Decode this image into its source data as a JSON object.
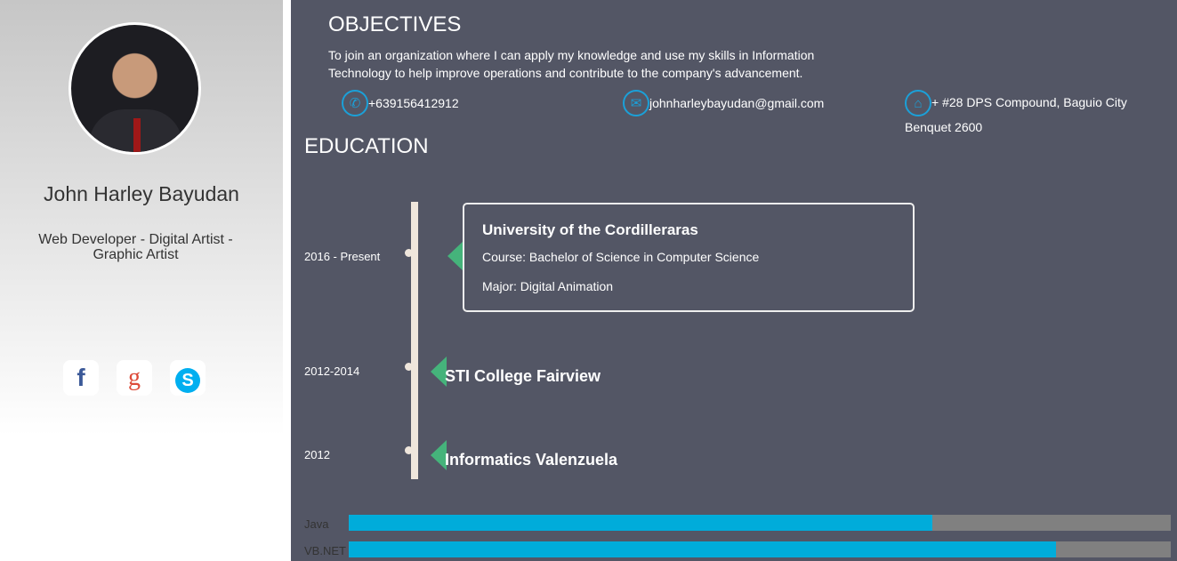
{
  "profile": {
    "name": "John Harley Bayudan",
    "role": "Web Developer - Digital Artist - Graphic Artist"
  },
  "social": [
    {
      "icon": "facebook-icon",
      "glyph": "f",
      "color": "#3b5998"
    },
    {
      "icon": "google-icon",
      "glyph": "g",
      "color": "#dd4b39"
    },
    {
      "icon": "skype-icon",
      "glyph": "S",
      "color": "#00aff0"
    }
  ],
  "objectives": {
    "title": "OBJECTIVES",
    "text": "To join an organization where I can apply my knowledge and use my skills in Information Technology to help improve operations and contribute to the company's advancement."
  },
  "contact": {
    "phone": "+639156412912",
    "email": "johnharleybayudan@gmail.com",
    "address_line1": "+ #28 DPS Compound, Baguio City",
    "address_line2": "Benquet 2600"
  },
  "education": {
    "title": "EDUCATION",
    "items": [
      {
        "date": "2016 - Present",
        "school": "University of the Cordilleraras",
        "course": "Course: Bachelor of Science in Computer Science",
        "major": "Major: Digital Animation"
      },
      {
        "date": "2012-2014",
        "school": "STI College Fairview"
      },
      {
        "date": "2012",
        "school": "Informatics Valenzuela"
      }
    ]
  },
  "skills": [
    {
      "name": "Java",
      "percent": 71
    },
    {
      "name": "VB.NET",
      "percent": 86
    }
  ]
}
